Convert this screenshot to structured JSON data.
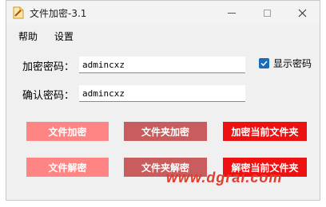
{
  "window": {
    "title": "文件加密-3.1",
    "icons": {
      "app": "file-lock-icon",
      "minimize": "minimize-icon",
      "maximize": "maximize-icon",
      "close": "close-icon"
    }
  },
  "menu": {
    "help": "帮助",
    "settings": "设置"
  },
  "form": {
    "password_label": "加密密码：",
    "password_value": "admincxz",
    "confirm_label": "确认密码：",
    "confirm_value": "admincxz",
    "show_password_label": "显示密码",
    "show_password_checked": true
  },
  "buttons": {
    "encrypt_file": "文件加密",
    "encrypt_folder": "文件夹加密",
    "encrypt_current_folder": "加密当前文件夹",
    "decrypt_file": "文件解密",
    "decrypt_folder": "文件夹解密",
    "decrypt_current_folder": "解密当前文件夹"
  },
  "colors": {
    "btn_light_red": "#ff8585",
    "btn_dark_red": "#c95c5c",
    "btn_bright_red": "#ee1111",
    "checkbox_blue": "#1d6bb5",
    "watermark": "#e33c2c"
  },
  "watermark": "www.dgrai.com"
}
